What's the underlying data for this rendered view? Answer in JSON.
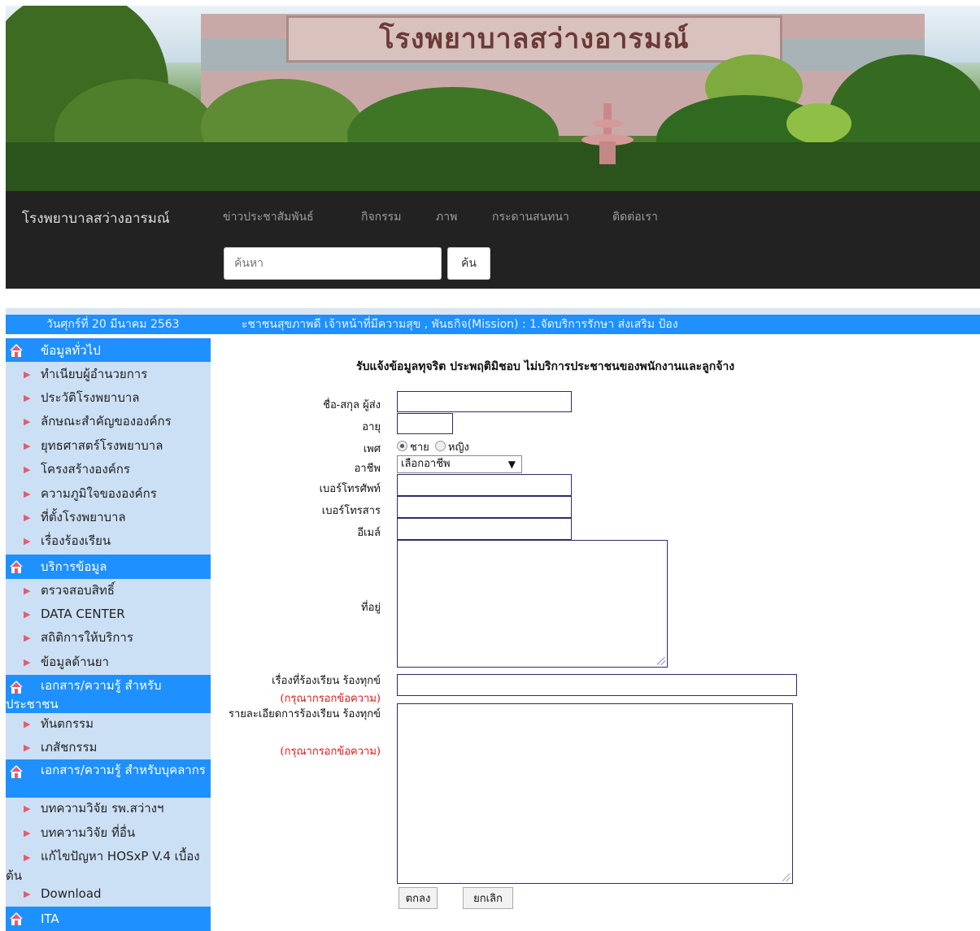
{
  "banner": {
    "sign_text": "โรงพยาบาลสว่างอารมณ์"
  },
  "navbar": {
    "brand": "โรงพยาบาลสว่างอารมณ์",
    "links": [
      "ข่าวประชาสัมพันธ์",
      "กิจกรรม",
      "ภาพ",
      "กระดานสนทนา",
      "ติดต่อเรา"
    ],
    "search_placeholder": "ค้นหา",
    "search_button": "ค้น"
  },
  "infobar": {
    "date": "วันศุกร์ที่ 20 มีนาคม 2563",
    "marquee": "ะชาชนสุขภาพดี เจ้าหน้าที่มีความสุข , พันธกิจ(Mission) : 1.จัดบริการรักษา ส่งเสริม ป้อง"
  },
  "sidebar": {
    "sections": [
      {
        "title": "ข้อมูลทั่วไป",
        "items": [
          "ทำเนียบผู้อำนวยการ",
          "ประวัติโรงพยาบาล",
          "ลักษณะสำคัญขององค์กร",
          "ยุทธศาสตร์โรงพยาบาล",
          "โครงสร้างองค์กร",
          "ความภูมิใจขององค์กร",
          "ที่ตั้งโรงพยาบาล",
          "เรื่องร้องเรียน"
        ]
      },
      {
        "title": "บริการข้อมูล",
        "items": [
          "ตรวจสอบสิทธิ์",
          "DATA CENTER",
          "สถิติการให้บริการ",
          "ข้อมูลด้านยา"
        ]
      },
      {
        "title": "เอกสาร/ความรู้ สำหรับประชาชน",
        "items": [
          "ทันตกรรม",
          "เภสัชกรรม"
        ]
      },
      {
        "title": "เอกสาร/ความรู้ สำหรับบุคลากร",
        "items": [
          "บทความวิจัย รพ.สว่างฯ",
          "บทความวิจัย ที่อื่น",
          "แก้ไขปัญหา HOSxP V.4 เบื้องต้น",
          "Download"
        ]
      },
      {
        "title": "ITA",
        "items": []
      }
    ]
  },
  "form": {
    "title": "รับแจ้งข้อมูลทุจริต ประพฤติมิชอบ ไม่บริการประชาชนของพนักงานและลูกจ้าง",
    "labels": {
      "name": "ชื่อ-สกุล ผู้ส่ง",
      "age": "อายุ",
      "gender": "เพศ",
      "occupation": "อาชีพ",
      "phone": "เบอร์โทรศัพท์",
      "fax": "เบอร์โทรสาร",
      "email": "อีเมล์",
      "address": "ที่อยู่",
      "subject": "เรื่องที่ร้องเรียน ร้องทุกข์",
      "details": "รายละเอียดการร้องเรียน ร้องทุกข์"
    },
    "required_note": "(กรุณากรอกข้อความ)",
    "gender_options": [
      "ชาย",
      "หญิง"
    ],
    "gender_selected": "ชาย",
    "occupation_value": "เลือกอาชีพ",
    "submit": "ตกลง",
    "cancel": "ยกเลิก"
  },
  "colors": {
    "accent": "#1e90ff",
    "sidebar_bg": "#cce0f5",
    "navbar_bg": "#222222",
    "required": "#e01818"
  }
}
